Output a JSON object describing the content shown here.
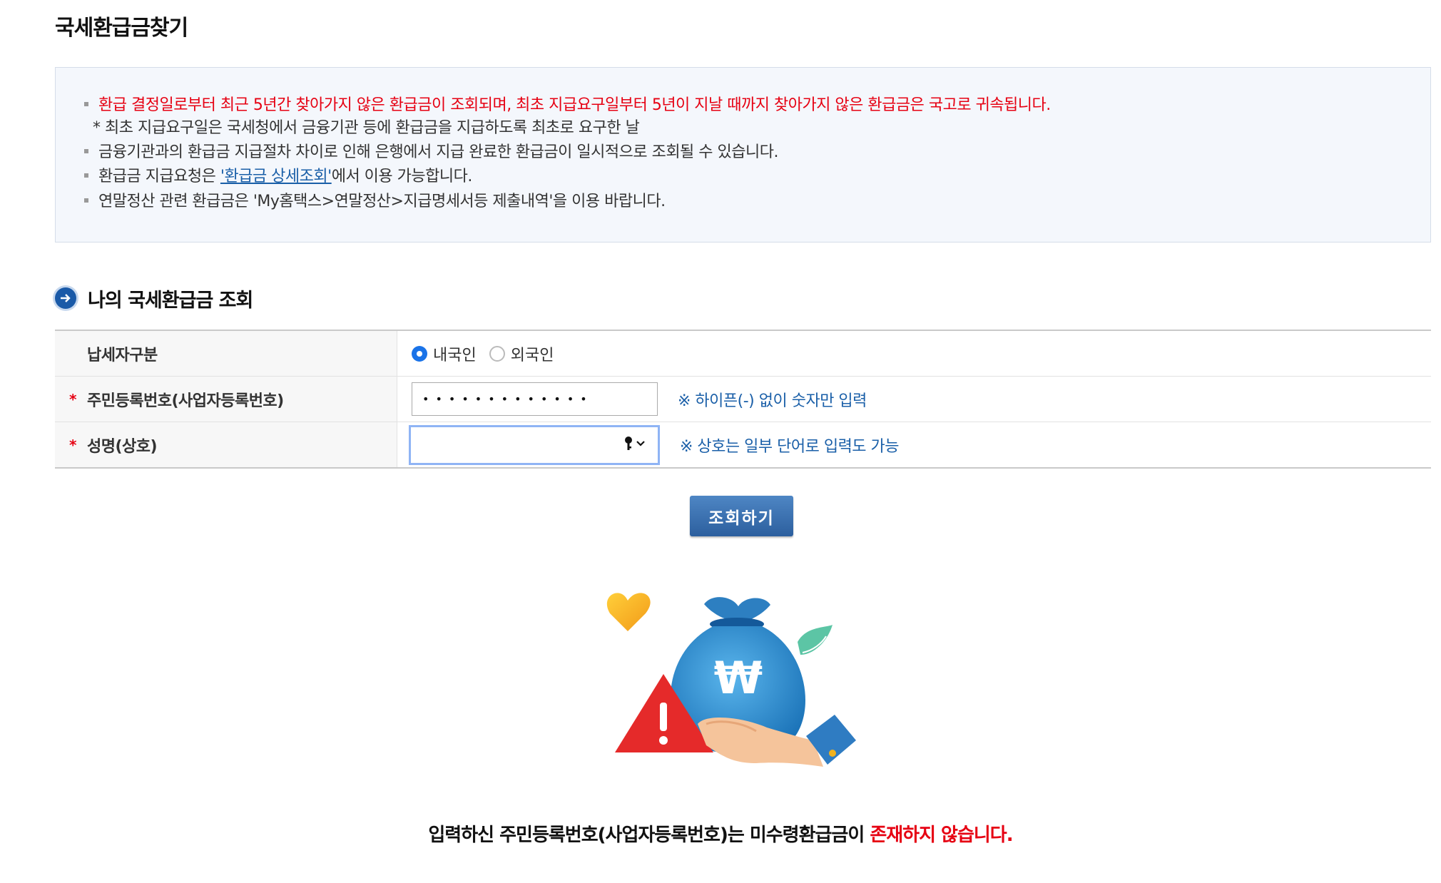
{
  "page_title": "국세환급금찾기",
  "notice": {
    "line1": "환급 결정일로부터 최근 5년간 찾아가지 않은 환급금이 조회되며, 최초 지급요구일부터 5년이 지날 때까지 찾아가지 않은 환급금은 국고로 귀속됩니다.",
    "line1_sub": "* 최초 지급요구일은 국세청에서 금융기관 등에 환급금을 지급하도록 최초로 요구한 날",
    "line2": "금융기관과의 환급금 지급절차 차이로 인해 은행에서 지급 완료한 환급금이 일시적으로 조회될 수 있습니다.",
    "line3_prefix": "환급금 지급요청은 ",
    "line3_link": "'환급금 상세조회'",
    "line3_suffix": "에서 이용 가능합니다.",
    "line4": "연말정산 관련 환급금은 'My홈택스>연말정산>지급명세서등 제출내역'을 이용 바랍니다."
  },
  "section": {
    "title": "나의 국세환급금 조회"
  },
  "form": {
    "taxpayer_type_label": "납세자구분",
    "option_domestic": "내국인",
    "option_foreign": "외국인",
    "id_label": "주민등록번호(사업자등록번호)",
    "id_value": "•••••••••••••",
    "id_hint": "※ 하이픈(-) 없이 숫자만 입력",
    "name_label": "성명(상호)",
    "name_value": "",
    "name_hint": "※ 상호는 일부 단어로 입력도 가능",
    "required_mark": "*"
  },
  "search_button": "조회하기",
  "result": {
    "prefix": "입력하신 주민등록번호(사업자등록번호)는 미수령환급금이 ",
    "emphasis": "존재하지 않습니다."
  },
  "colors": {
    "accent": "#1a5fa8",
    "alert": "#e60012",
    "button": "#2c5f9e"
  }
}
